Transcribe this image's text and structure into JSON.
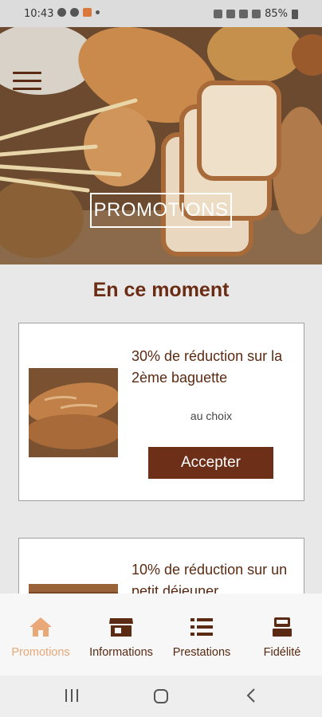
{
  "status_bar": {
    "time": "10:43",
    "battery": "85%"
  },
  "hero": {
    "title": "PROMOTIONS"
  },
  "section": {
    "title": "En ce moment"
  },
  "offers": [
    {
      "title": "30% de réduction sur la 2ème baguette",
      "note": "au choix",
      "button": "Accepter"
    },
    {
      "title": "10% de réduction sur un petit déjeuner"
    }
  ],
  "bottom_nav": {
    "items": [
      {
        "label": "Promotions",
        "icon": "home-icon",
        "active": true
      },
      {
        "label": "Informations",
        "icon": "store-icon",
        "active": false
      },
      {
        "label": "Prestations",
        "icon": "list-icon",
        "active": false
      },
      {
        "label": "Fidélité",
        "icon": "register-icon",
        "active": false
      }
    ]
  },
  "colors": {
    "brand": "#6e2f18",
    "active_nav": "#e8a878",
    "background": "#e9e8e8"
  }
}
